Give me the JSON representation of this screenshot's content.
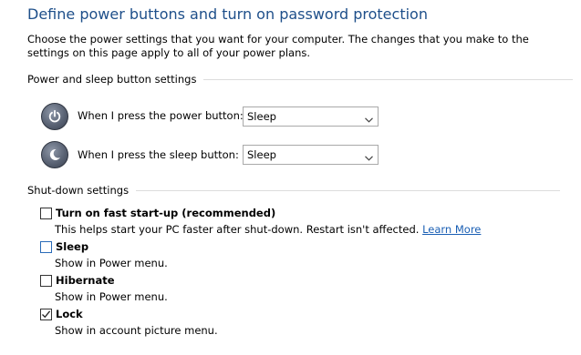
{
  "page": {
    "title": "Define power buttons and turn on password protection",
    "description": "Choose the power settings that you want for your computer. The changes that you make to the settings on this page apply to all of your power plans."
  },
  "power_section": {
    "header": "Power and sleep button settings",
    "power_button": {
      "label": "When I press the power button:",
      "value": "Sleep",
      "icon": "power-icon"
    },
    "sleep_button": {
      "label": "When I press the sleep button:",
      "value": "Sleep",
      "icon": "moon-icon"
    }
  },
  "shutdown_section": {
    "header": "Shut-down settings",
    "fast_startup": {
      "label": "Turn on fast start-up (recommended)",
      "description": "This helps start your PC faster after shut-down. Restart isn't affected.",
      "link": "Learn More",
      "checked": false
    },
    "sleep": {
      "label": "Sleep",
      "description": "Show in Power menu.",
      "checked": false
    },
    "hibernate": {
      "label": "Hibernate",
      "description": "Show in Power menu.",
      "checked": false
    },
    "lock": {
      "label": "Lock",
      "description": "Show in account picture menu.",
      "checked": true
    }
  },
  "colors": {
    "title": "#1e4f8a",
    "link": "#1a5fb4",
    "rule": "#dcdcdc"
  }
}
